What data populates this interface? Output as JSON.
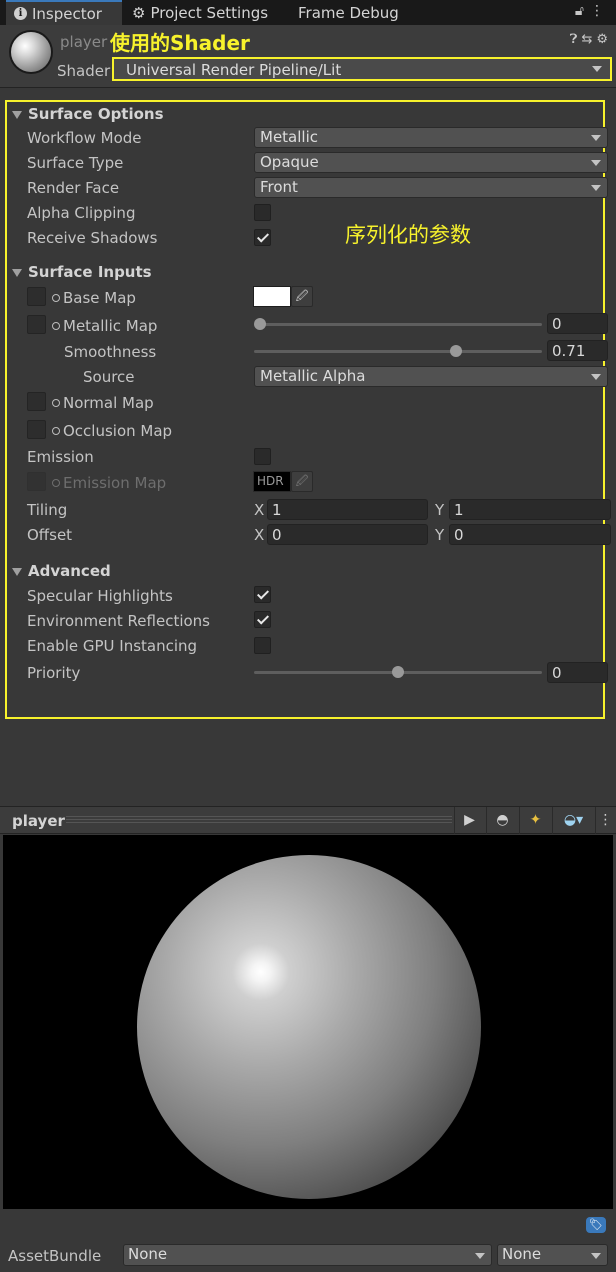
{
  "tabs": {
    "inspector": "Inspector",
    "project_settings": "Project Settings",
    "frame_debug": "Frame Debug"
  },
  "header": {
    "asset_name": "player",
    "annotation_shader": "使用的Shader",
    "shader_label": "Shader",
    "shader_value": "Universal Render Pipeline/Lit"
  },
  "annotation_params": "序列化的参数",
  "surface_options": {
    "title": "Surface Options",
    "workflow_mode_label": "Workflow Mode",
    "workflow_mode_value": "Metallic",
    "surface_type_label": "Surface Type",
    "surface_type_value": "Opaque",
    "render_face_label": "Render Face",
    "render_face_value": "Front",
    "alpha_clipping_label": "Alpha Clipping",
    "alpha_clipping_checked": false,
    "receive_shadows_label": "Receive Shadows",
    "receive_shadows_checked": true
  },
  "surface_inputs": {
    "title": "Surface Inputs",
    "base_map_label": "Base Map",
    "base_map_color": "#ffffff",
    "metallic_map_label": "Metallic Map",
    "metallic_value": "0",
    "metallic_fraction": 0,
    "smoothness_label": "Smoothness",
    "smoothness_value": "0.71",
    "smoothness_fraction": 0.71,
    "source_label": "Source",
    "source_value": "Metallic Alpha",
    "normal_map_label": "Normal Map",
    "occlusion_map_label": "Occlusion Map",
    "emission_label": "Emission",
    "emission_checked": false,
    "emission_map_label": "Emission Map",
    "hdr_label": "HDR",
    "tiling_label": "Tiling",
    "tiling_x_label": "X",
    "tiling_x": "1",
    "tiling_y_label": "Y",
    "tiling_y": "1",
    "offset_label": "Offset",
    "offset_x_label": "X",
    "offset_x": "0",
    "offset_y_label": "Y",
    "offset_y": "0"
  },
  "advanced": {
    "title": "Advanced",
    "specular_label": "Specular Highlights",
    "specular_checked": true,
    "env_reflections_label": "Environment Reflections",
    "env_reflections_checked": true,
    "gpu_instancing_label": "Enable GPU Instancing",
    "gpu_instancing_checked": false,
    "priority_label": "Priority",
    "priority_value": "0",
    "priority_fraction": 0.5
  },
  "preview": {
    "title": "player"
  },
  "asset_bundle": {
    "label": "AssetBundle",
    "bundle_value": "None",
    "variant_value": "None"
  },
  "colors": {
    "annotation": "#f7f22c",
    "accent": "#3a79bb",
    "panel_bg": "#383838"
  },
  "icons": [
    "info-icon",
    "gear-icon",
    "lock-icon",
    "menu-icon",
    "help-icon",
    "presets-icon",
    "play-icon",
    "sphere-mesh-icon",
    "light-icon",
    "skybox-icon",
    "label-tag-icon",
    "eyedropper-icon"
  ]
}
